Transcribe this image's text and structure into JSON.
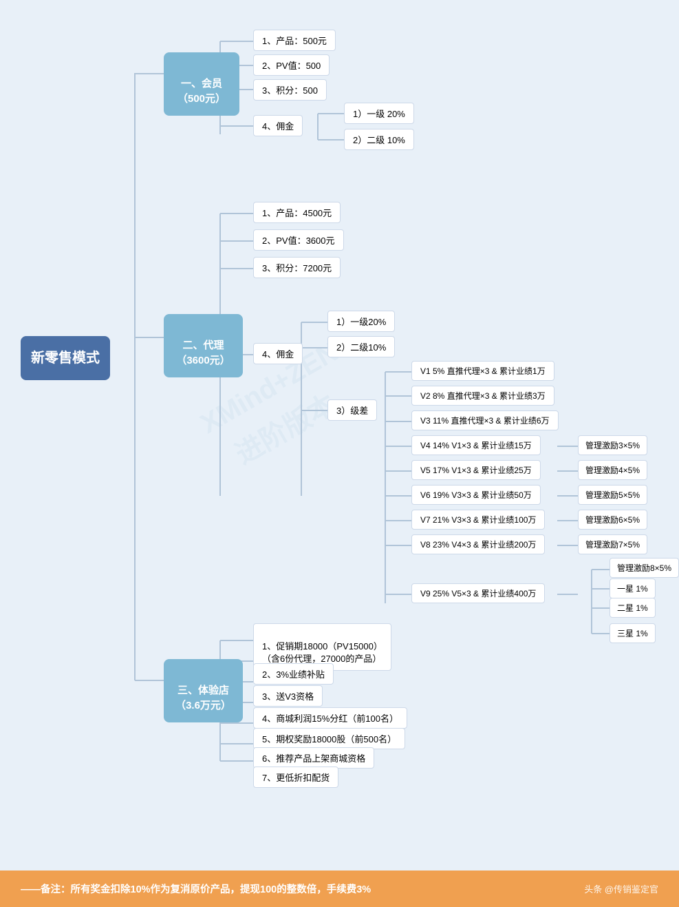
{
  "page": {
    "background_color": "#e8f0f8",
    "watermark": "XMind+ZEN\n进阶版本"
  },
  "root": {
    "label": "新零售模式"
  },
  "branches": [
    {
      "id": "huiyuan",
      "label": "一、会员\n（500元）",
      "children": [
        {
          "id": "h1",
          "label": "1、产品：500元"
        },
        {
          "id": "h2",
          "label": "2、PV值：500"
        },
        {
          "id": "h3",
          "label": "3、积分：500"
        },
        {
          "id": "h4",
          "label": "4、佣金",
          "children": [
            {
              "id": "h4a",
              "label": "1）一级 20%"
            },
            {
              "id": "h4b",
              "label": "2）二级 10%"
            }
          ]
        }
      ]
    },
    {
      "id": "daili",
      "label": "二、代理\n（3600元）",
      "children": [
        {
          "id": "d1",
          "label": "1、产品：4500元"
        },
        {
          "id": "d2",
          "label": "2、PV值：3600元"
        },
        {
          "id": "d3",
          "label": "3、积分：7200元"
        },
        {
          "id": "d4",
          "label": "4、佣金",
          "children": [
            {
              "id": "d4a",
              "label": "1）一级20%"
            },
            {
              "id": "d4b",
              "label": "2）二级10%"
            },
            {
              "id": "d4c",
              "label": "3）级差",
              "children": [
                {
                  "id": "v1",
                  "label": "V1  5%  直推代理×3 & 累计业绩1万"
                },
                {
                  "id": "v2",
                  "label": "V2  8%  直推代理×3 & 累计业绩3万"
                },
                {
                  "id": "v3",
                  "label": "V3  11%  直推代理×3 & 累计业绩6万"
                },
                {
                  "id": "v4",
                  "label": "V4  14%  V1×3 & 累计业绩15万",
                  "extra": "管理激励3×5%"
                },
                {
                  "id": "v5",
                  "label": "V5  17%  V1×3 & 累计业绩25万",
                  "extra": "管理激励4×5%"
                },
                {
                  "id": "v6",
                  "label": "V6  19%  V3×3 & 累计业绩50万",
                  "extra": "管理激励5×5%"
                },
                {
                  "id": "v7",
                  "label": "V7  21%  V3×3 & 累计业绩100万",
                  "extra": "管理激励6×5%"
                },
                {
                  "id": "v8",
                  "label": "V8  23%  V4×3 & 累计业绩200万",
                  "extra": "管理激励7×5%"
                },
                {
                  "id": "v9",
                  "label": "V9  25%  V5×3 & 累计业绩400万",
                  "extras": [
                    "管理激励8×5%",
                    "一星 1%",
                    "二星 1%",
                    "三星 1%"
                  ]
                }
              ]
            }
          ]
        }
      ]
    },
    {
      "id": "tiyandiann",
      "label": "三、体验店\n（3.6万元）",
      "children": [
        {
          "id": "t1",
          "label": "1、促销期18000（PV15000）\n（含6份代理，27000的产品）"
        },
        {
          "id": "t2",
          "label": "2、3%业绩补贴"
        },
        {
          "id": "t3",
          "label": "3、送V3资格"
        },
        {
          "id": "t4",
          "label": "4、商城利润15%分红（前100名）"
        },
        {
          "id": "t5",
          "label": "5、期权奖励18000股（前500名）"
        },
        {
          "id": "t6",
          "label": "6、推荐产品上架商城资格"
        },
        {
          "id": "t7",
          "label": "7、更低折扣配货"
        }
      ]
    }
  ],
  "footer": {
    "text": "——备注：所有奖金扣除10%作为复消原价产品，提现100的整数倍，手续费3%",
    "source": "头条 @传销鉴定官"
  }
}
